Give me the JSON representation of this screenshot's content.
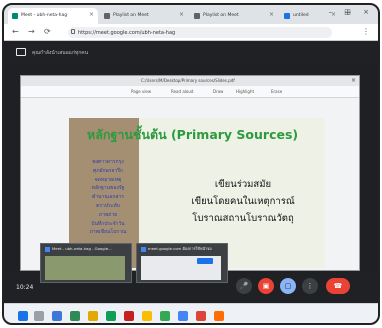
{
  "browser": {
    "tabs": [
      {
        "label": "Meet - ubh-neta-hag",
        "close": "×",
        "favicon_color": "#00897b"
      },
      {
        "label": "Playlist on Meet",
        "close": "×",
        "favicon_color": "#5f6368"
      },
      {
        "label": "Playlist on Meet",
        "close": "×",
        "favicon_color": "#5f6368"
      },
      {
        "label": "untiled",
        "close": "×",
        "favicon_color": "#1a73e8"
      }
    ],
    "new_tab": "+",
    "window_controls": "– □ ×",
    "url": "https://meet.google.com/ubh-neta-hag",
    "menu": "⋮",
    "nav": {
      "back": "←",
      "forward": "→",
      "reload": "⟳"
    }
  },
  "meet": {
    "presenting_text": "คุณกำลังนำเสนอแก่ทุกคน",
    "clock": "10:24"
  },
  "shared_window": {
    "title": "C:/Users/M/Desktop/Primary sources/Slides.pdf",
    "tools": [
      "Page view",
      "Read aloud",
      "Draw",
      "Highlight",
      "Erase"
    ],
    "close": "×"
  },
  "slide": {
    "title": "หลักฐานชั้นต้น (Primary Sources)",
    "left_list": [
      "พงศาวดารกรุง",
      "ศุภอักษรจารึก",
      "จดหมายเหตุ",
      "หลักฐานของรัฐ",
      "ตำนานเอกสาร",
      "ตราประทับ",
      "ภาพถ่าย",
      "บันทึกประจำวัน",
      "ภาพเขียนโบราณ"
    ],
    "right_lines": [
      "เขียนร่วมสมัย",
      "เขียนโดยคนในเหตุการณ์",
      "โบราณสถานโบราณวัตถุ"
    ]
  },
  "thumbnails": [
    {
      "label": "Meet - ubh-neta-hag - Google..."
    },
    {
      "label": "meet.google.com ต้องการใช้หน้าจอ"
    }
  ],
  "controls": {
    "mic": "🎤",
    "camera": "▣",
    "present": "▢",
    "more": "⋮",
    "leave": "☎"
  },
  "colors": {
    "meet_dark": "#202124",
    "slide_title": "#2e9a3e",
    "slide_left_panel": "#a48f72",
    "leave_red": "#ea4335"
  }
}
